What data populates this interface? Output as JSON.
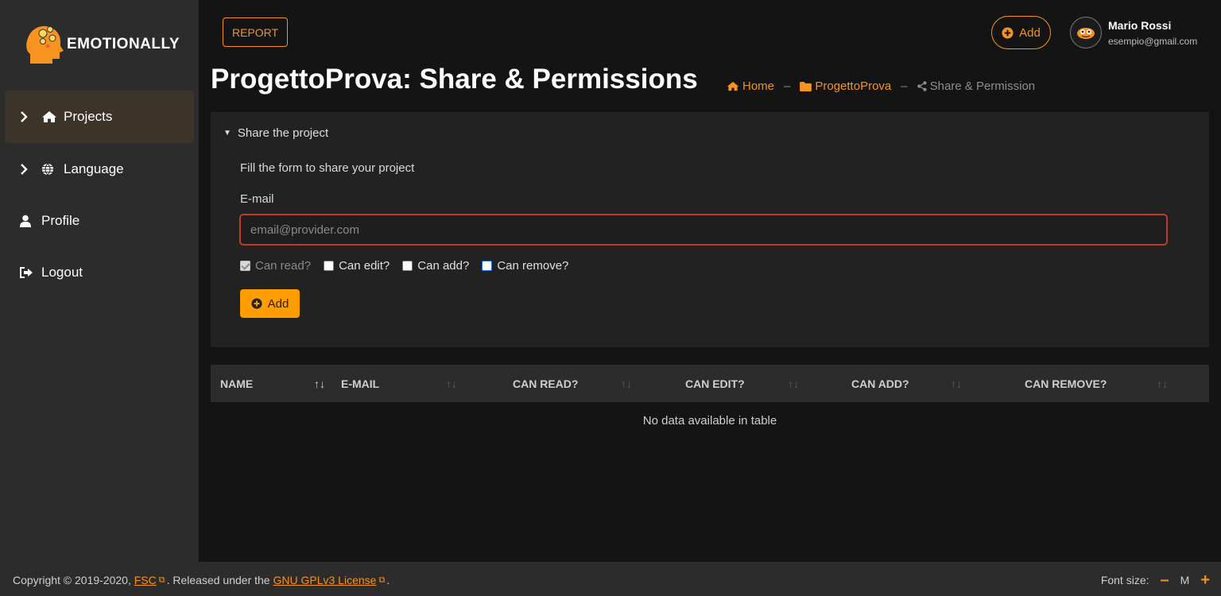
{
  "brand": {
    "name": "EMOTIONALLY"
  },
  "sidebar": {
    "items": [
      {
        "label": "Projects",
        "icon": "home-icon",
        "chevron": true,
        "active": true
      },
      {
        "label": "Language",
        "icon": "globe-icon",
        "chevron": true,
        "active": false
      },
      {
        "label": "Profile",
        "icon": "user-icon",
        "chevron": false,
        "active": false
      },
      {
        "label": "Logout",
        "icon": "sign-out-icon",
        "chevron": false,
        "active": false
      }
    ]
  },
  "header": {
    "report_label": "REPORT",
    "add_label": "Add",
    "user": {
      "name": "Mario Rossi",
      "email": "esempio@gmail.com"
    }
  },
  "page": {
    "title": "ProgettoProva: Share & Permissions",
    "breadcrumb": [
      {
        "label": "Home",
        "icon": "home-icon"
      },
      {
        "label": "ProgettoProva",
        "icon": "folder-icon"
      },
      {
        "label": "Share & Permission",
        "icon": "share-icon"
      }
    ],
    "breadcrumb_separator": "–"
  },
  "share_form": {
    "summary": "Share the project",
    "description": "Fill the form to share your project",
    "email_label": "E-mail",
    "email_placeholder": "email@provider.com",
    "email_value": "",
    "checkboxes": [
      {
        "label": "Can read?",
        "checked": true,
        "disabled": true
      },
      {
        "label": "Can edit?",
        "checked": false,
        "disabled": false
      },
      {
        "label": "Can add?",
        "checked": false,
        "disabled": false
      },
      {
        "label": "Can remove?",
        "checked": false,
        "disabled": false
      }
    ],
    "add_label": "Add"
  },
  "table": {
    "columns": [
      "NAME",
      "E-MAIL",
      "CAN READ?",
      "CAN EDIT?",
      "CAN ADD?",
      "CAN REMOVE?"
    ],
    "sort_glyph": "↑↓",
    "empty_message": "No data available in table"
  },
  "footer": {
    "copyright_prefix": "Copyright © 2019-2020,",
    "fsc_link": "FSC",
    "middle_text": ". Released under the",
    "license_link": "GNU GPLv3 License",
    "end_text": ".",
    "font_size_label": "Font size:",
    "font_size_decrease": "–",
    "font_size_current": "M",
    "font_size_increase": "+"
  },
  "colors": {
    "accent": "#f7931e",
    "button_fill": "#ff9c00",
    "sidebar_bg": "#2c2c2c",
    "main_bg": "#141414",
    "card_bg": "#222222",
    "input_error_border": "#c0392b"
  }
}
